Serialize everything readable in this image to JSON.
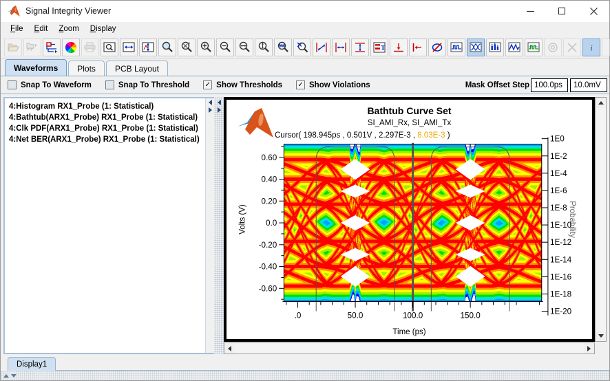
{
  "window": {
    "title": "Signal Integrity Viewer",
    "icon": "matlab-icon",
    "controls": {
      "minimize": "–",
      "maximize": "□",
      "close": "✕"
    }
  },
  "menubar": {
    "items": [
      {
        "label": "File",
        "mnemonic": "F"
      },
      {
        "label": "Edit",
        "mnemonic": "E"
      },
      {
        "label": "Zoom",
        "mnemonic": "Z"
      },
      {
        "label": "Display",
        "mnemonic": "D"
      }
    ]
  },
  "toolbar": {
    "buttons": [
      {
        "name": "open-icon",
        "enabled": false
      },
      {
        "name": "open-project-icon",
        "enabled": false
      },
      {
        "name": "schematic-icon",
        "enabled": true
      },
      {
        "name": "color-wheel-icon",
        "enabled": true
      },
      {
        "name": "print-icon",
        "enabled": false
      },
      {
        "name": "zoom-page-icon",
        "enabled": true
      },
      {
        "name": "zoom-horizontal-fit-icon",
        "enabled": true
      },
      {
        "name": "zoom-vertical-fit-icon",
        "enabled": true
      },
      {
        "name": "magnifier-icon",
        "enabled": true
      },
      {
        "name": "zoom-xy-icon",
        "enabled": true
      },
      {
        "name": "zoom-in-icon",
        "enabled": true
      },
      {
        "name": "zoom-out-icon",
        "enabled": true
      },
      {
        "name": "zoom-horizontal-icon",
        "enabled": true
      },
      {
        "name": "zoom-vertical-icon",
        "enabled": true
      },
      {
        "name": "zoom-previous-icon",
        "enabled": true
      },
      {
        "name": "zoom-reset-icon",
        "enabled": true
      },
      {
        "name": "cursor-diagonal-icon",
        "enabled": true
      },
      {
        "name": "cursor-horizontal-icon",
        "enabled": true
      },
      {
        "name": "cursor-vertical-icon",
        "enabled": true
      },
      {
        "name": "text-annotation-icon",
        "enabled": true
      },
      {
        "name": "marker-down-icon",
        "enabled": true
      },
      {
        "name": "marker-left-icon",
        "enabled": true
      },
      {
        "name": "no-circle-icon",
        "enabled": true
      },
      {
        "name": "waveform-icon",
        "enabled": true
      },
      {
        "name": "eye-diagram-icon",
        "enabled": true,
        "selected": true
      },
      {
        "name": "histogram-icon",
        "enabled": true
      },
      {
        "name": "analog-wave-icon",
        "enabled": true
      },
      {
        "name": "digital-wave-icon",
        "enabled": true
      },
      {
        "name": "target-icon",
        "enabled": false
      },
      {
        "name": "delete-icon",
        "enabled": false
      },
      {
        "name": "info-icon",
        "enabled": true,
        "selected": true
      },
      {
        "name": "blank-icon",
        "enabled": false
      }
    ]
  },
  "tabs": {
    "items": [
      {
        "label": "Waveforms",
        "active": true
      },
      {
        "label": "Plots",
        "active": false
      },
      {
        "label": "PCB Layout",
        "active": false
      }
    ]
  },
  "options": {
    "checkboxes": [
      {
        "label": "Snap To Waveform",
        "checked": false
      },
      {
        "label": "Snap To Threshold",
        "checked": false
      },
      {
        "label": "Show Thresholds",
        "checked": true
      },
      {
        "label": "Show Violations",
        "checked": true
      }
    ],
    "mask_offset_step_label": "Mask Offset Step",
    "mask_offset_time": "100.0ps",
    "mask_offset_voltage": "10.0mV"
  },
  "waveform_list": {
    "items": [
      "4:Histogram RX1_Probe  (1: Statistical)",
      "4:Bathtub(ARX1_Probe) RX1_Probe  (1: Statistical)",
      "4:Clk PDF(ARX1_Probe) RX1_Probe  (1: Statistical)",
      "4:Net BER(ARX1_Probe) RX1_Probe  (1: Statistical)"
    ]
  },
  "bottom": {
    "display_tab": "Display1"
  },
  "chart_data": {
    "type": "heatmap",
    "title": "Bathtub Curve Set",
    "subtitle": "SI_AMI_Rx, SI_AMI_Tx",
    "cursor": {
      "prefix": "Cursor(",
      "time": "198.945ps",
      "voltage": "0.501V",
      "value1": "2.297E-3",
      "value2": "8.03E-3",
      "suffix": ")",
      "highlight_color": "#f0a400"
    },
    "xlabel": "Time (ps)",
    "ylabel": "Volts (V)",
    "ylabel_right": "Probability",
    "xlim": [
      -12.0,
      212.0
    ],
    "ylim": [
      -0.72,
      0.72
    ],
    "xticks": [
      ".0",
      "50.0",
      "100.0",
      "150.0"
    ],
    "xtick_values": [
      0,
      50,
      100,
      150
    ],
    "yticks": [
      "0.60",
      "0.40",
      "0.20",
      "0.0",
      "-0.20",
      "-0.40",
      "-0.60"
    ],
    "ytick_values": [
      0.6,
      0.4,
      0.2,
      0.0,
      -0.2,
      -0.4,
      -0.6
    ],
    "yticks_right": [
      "1E0",
      "1E-2",
      "1E-4",
      "1E-6",
      "1E-8",
      "1E-10",
      "1E-12",
      "1E-14",
      "1E-16",
      "1E-18",
      "1E-20"
    ],
    "ytick_right_values": [
      0,
      -2,
      -4,
      -6,
      -8,
      -10,
      -12,
      -14,
      -16,
      -18,
      -20
    ],
    "grid": false,
    "legend": "none",
    "colormap": [
      "#0000ff",
      "#00a0ff",
      "#00e0e0",
      "#00e000",
      "#a0f000",
      "#ffff00",
      "#ff9000",
      "#ff0000"
    ],
    "series": [
      {
        "name": "eye-density-heatmap",
        "description": "Eye diagram density, 2 unit intervals, jet colormap"
      },
      {
        "name": "bathtub-curve-1",
        "description": "Bathtub curve overlay at UI 1",
        "color": "#555555"
      },
      {
        "name": "bathtub-curve-2",
        "description": "Bathtub curve overlay at UI 2",
        "color": "#555555"
      },
      {
        "name": "cursor-marker",
        "description": "Vertical cursor at 100 ps",
        "color": "#555555"
      }
    ]
  }
}
